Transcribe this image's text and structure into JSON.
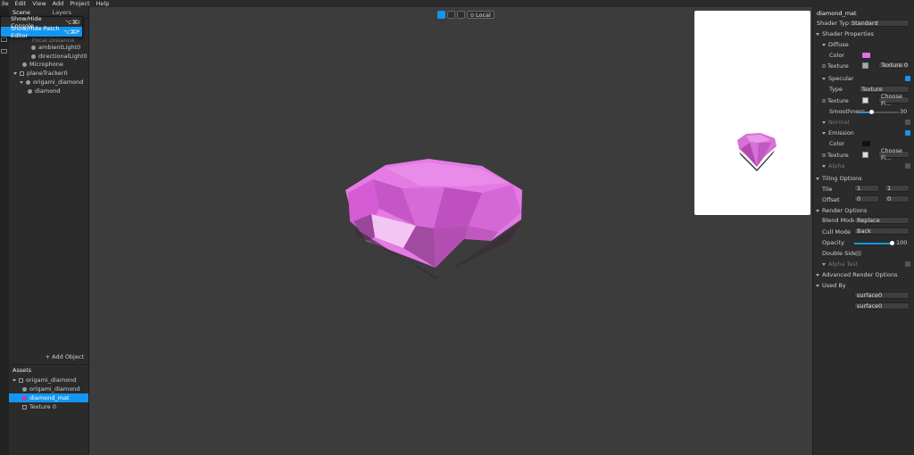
{
  "menubar": {
    "items": [
      "File",
      "Edit",
      "View",
      "Add",
      "Project",
      "Help"
    ],
    "visible": [
      "ile",
      "Edit",
      "View",
      "Add",
      "Project",
      "Help"
    ]
  },
  "scene": {
    "tabs": [
      "Scene",
      "Layers"
    ],
    "items": [
      {
        "label": "ambientLight0"
      },
      {
        "label": "directionalLight0"
      },
      {
        "label": "Microphone"
      },
      {
        "label": "planeTracker0"
      },
      {
        "label": "origami_diamond"
      },
      {
        "label": "diamond"
      }
    ],
    "partial_item": "Focal Distance",
    "add_object": "+ Add Object"
  },
  "context_menu": {
    "items": [
      {
        "label": "Show/Hide Console",
        "shortcut": "⌥⌘I"
      },
      {
        "label": "Show/Hide Patch Editor",
        "shortcut": "⌥⌘P"
      }
    ]
  },
  "assets": {
    "title": "Assets",
    "items": [
      {
        "label": "origami_diamond"
      },
      {
        "label": "origami_diamond"
      },
      {
        "label": "diamond_mat"
      },
      {
        "label": "Texture 0"
      }
    ]
  },
  "viewport": {
    "local_label": "Local"
  },
  "inspector": {
    "title": "diamond_mat",
    "shader_type_label": "Shader Type",
    "shader_type_value": "Standard",
    "shader_properties": "Shader Properties",
    "diffuse": "Diffuse",
    "color": "Color",
    "texture": "Texture",
    "texture0": "Texture 0",
    "specular": "Specular",
    "type": "Type",
    "type_value": "Texture",
    "choose_file": "Choose Fi...",
    "smoothness": "Smoothness",
    "smoothness_value": "30",
    "smoothness_level": 0.3,
    "normal": "Normal",
    "emission": "Emission",
    "alpha": "Alpha",
    "tiling": "Tiling Options",
    "tile": "Tile",
    "tile_x": "1",
    "tile_y": "1",
    "offset": "Offset",
    "offset_x": "0",
    "offset_y": "0",
    "render_options": "Render Options",
    "blend_mode": "Blend Mode",
    "blend_value": "Replace",
    "cull_mode": "Cull Mode",
    "cull_value": "Back",
    "opacity": "Opacity",
    "opacity_value": "100",
    "opacity_level": 1.0,
    "double_sided": "Double Sided",
    "alpha_test": "Alpha Test",
    "advanced": "Advanced Render Options",
    "used_by": "Used By",
    "used_items": [
      "surface0",
      "surface0"
    ]
  },
  "colors": {
    "accent": "#1496f0",
    "diamond": "#e070e0"
  }
}
